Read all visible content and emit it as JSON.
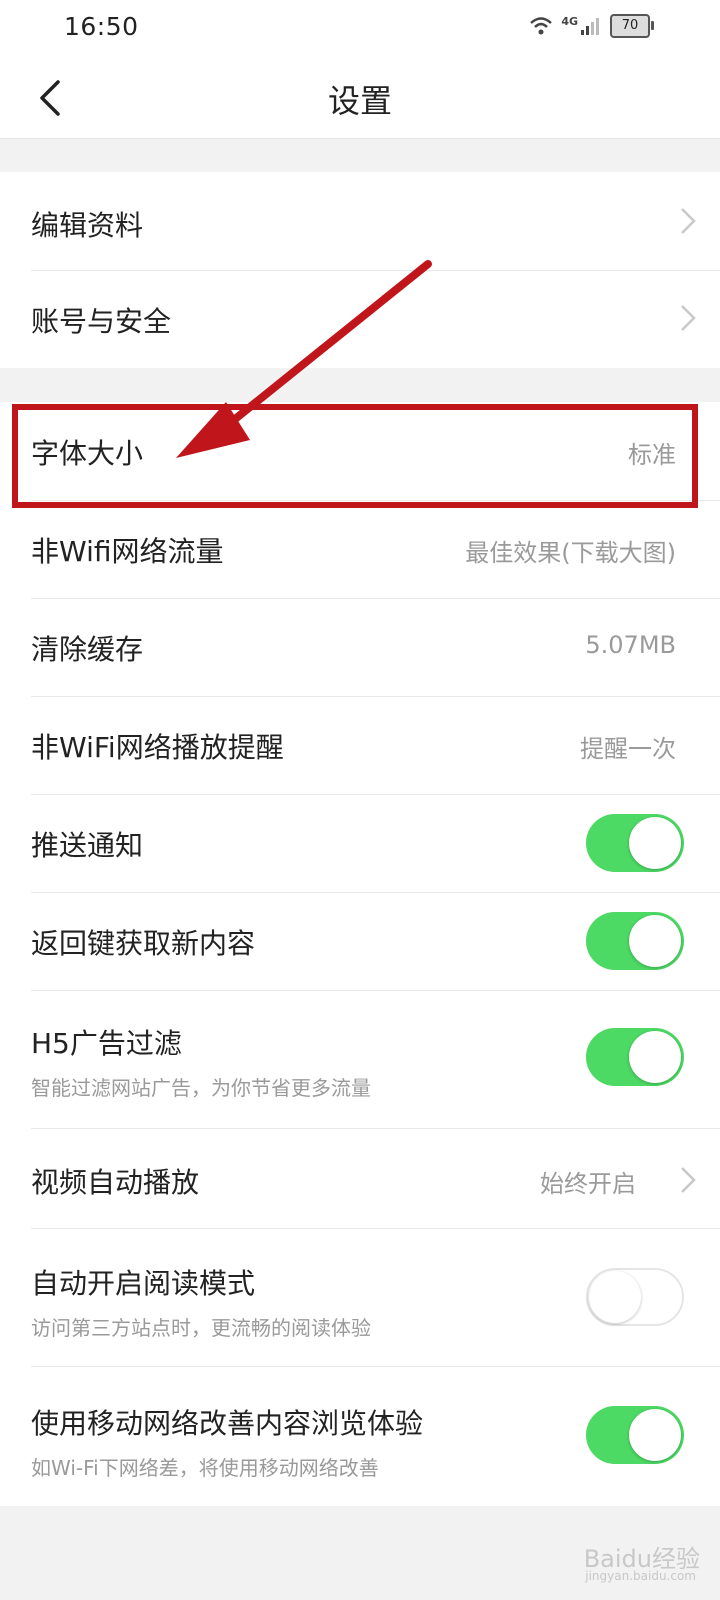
{
  "status_bar": {
    "time": "16:50",
    "network": "4G",
    "battery": "70",
    "icons": [
      "wifi-icon",
      "signal-icon",
      "battery-icon"
    ]
  },
  "nav": {
    "title": "设置",
    "back_icon": "chevron-left-icon"
  },
  "group1": [
    {
      "label": "编辑资料"
    },
    {
      "label": "账号与安全"
    }
  ],
  "group2": {
    "font_size": {
      "label": "字体大小",
      "value": "标准"
    },
    "non_wifi_traffic": {
      "label": "非Wifi网络流量",
      "value": "最佳效果(下载大图)"
    },
    "clear_cache": {
      "label": "清除缓存",
      "value": "5.07MB"
    },
    "non_wifi_play": {
      "label": "非WiFi网络播放提醒",
      "value": "提醒一次"
    },
    "push": {
      "label": "推送通知",
      "on": true
    },
    "back_refresh": {
      "label": "返回键获取新内容",
      "on": true
    },
    "h5_filter": {
      "label": "H5广告过滤",
      "sub": "智能过滤网站广告，为你节省更多流量",
      "on": true
    },
    "video_autoplay": {
      "label": "视频自动播放",
      "value": "始终开启"
    },
    "reading_mode": {
      "label": "自动开启阅读模式",
      "sub": "访问第三方站点时，更流畅的阅读体验",
      "on": false
    },
    "mobile_improve": {
      "label": "使用移动网络改善内容浏览体验",
      "sub": "如Wi-Fi下网络差，将使用移动网络改善",
      "on": true
    }
  },
  "watermark": {
    "text": "Baidu经验",
    "sub": "jingyan.baidu.com"
  },
  "colors": {
    "toggle_on": "#4cd964",
    "annotation": "#c0161b"
  }
}
